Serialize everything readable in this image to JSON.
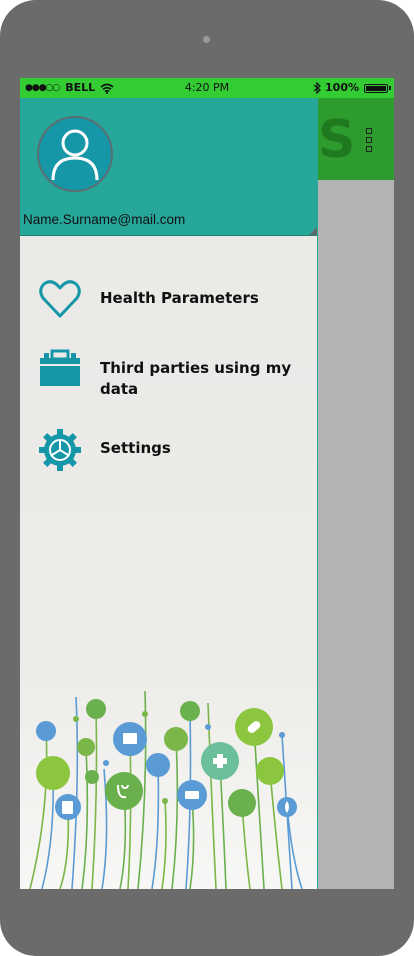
{
  "status_bar": {
    "signal": "●●●○○",
    "carrier": "BELL",
    "wifi_icon": "wifi-icon",
    "time": "4:20 PM",
    "bluetooth_icon": "bluetooth-icon",
    "battery": "100%",
    "battery_level": 1.0
  },
  "drawer": {
    "email": "Name.Surname@mail.com",
    "items": [
      {
        "label": "Health Parameters",
        "icon": "heart-icon"
      },
      {
        "label": "Third parties using my data",
        "icon": "briefcase-icon"
      },
      {
        "label": "Settings",
        "icon": "gear-icon"
      }
    ]
  },
  "background_app": {
    "title_fragment": "S",
    "menu_icon": "kebab-menu-icon"
  },
  "colors": {
    "status_bar": "#33cc33",
    "drawer_header": "#27a69a",
    "icon_accent": "#1597a8",
    "app_header": "#2e9b2e"
  }
}
